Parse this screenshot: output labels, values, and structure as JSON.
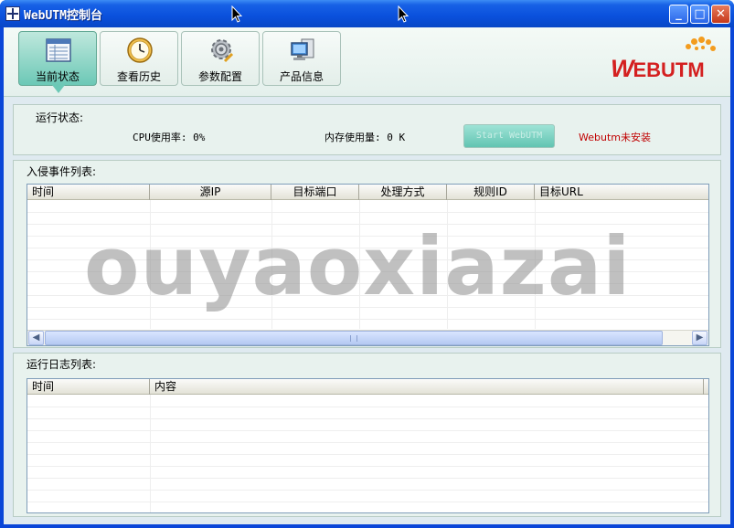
{
  "window": {
    "title": "WebUTM控制台",
    "minimize_glyph": "_",
    "maximize_glyph": "□",
    "close_glyph": "✕"
  },
  "toolbar": {
    "items": [
      {
        "label": "当前状态",
        "icon": "list-panel-icon",
        "active": true
      },
      {
        "label": "查看历史",
        "icon": "clock-icon",
        "active": false
      },
      {
        "label": "参数配置",
        "icon": "gear-icon",
        "active": false
      },
      {
        "label": "产品信息",
        "icon": "computer-icon",
        "active": false
      }
    ]
  },
  "logo": {
    "first_letter": "W",
    "rest": "EBUTM",
    "accent_color": "#f39c1e",
    "brand_color": "#d42020"
  },
  "status": {
    "label": "运行状态:",
    "cpu_text": "CPU使用率: 0%",
    "mem_text": "内存使用量: 0 K",
    "start_button": "Start WebUTM",
    "install_message": "Webutm未安装"
  },
  "intrusion_list": {
    "label": "入侵事件列表:",
    "columns": [
      "时间",
      "源IP",
      "目标端口",
      "处理方式",
      "规则ID",
      "目标URL"
    ],
    "rows": [],
    "scroll_grip": "|||"
  },
  "log_list": {
    "label": "运行日志列表:",
    "columns": [
      "时间",
      "内容"
    ],
    "rows": []
  },
  "watermark": "ouyaoxiazai"
}
